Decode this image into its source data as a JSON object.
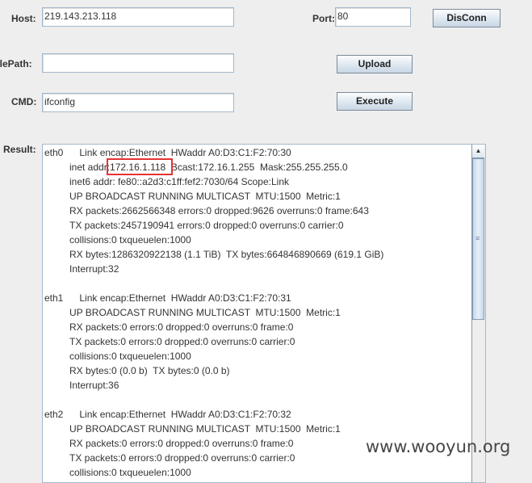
{
  "host": {
    "label": "Host:",
    "value": "219.143.213.118"
  },
  "port": {
    "label": "Port:",
    "value": "80"
  },
  "disconn_label": "DisConn",
  "filepath": {
    "label": "FilePath:",
    "value": ""
  },
  "upload_label": "Upload",
  "cmd": {
    "label": "CMD:",
    "value": "ifconfig"
  },
  "execute_label": "Execute",
  "result": {
    "label": "Result:",
    "lines": [
      "eth0      Link encap:Ethernet  HWaddr A0:D3:C1:F2:70:30",
      "inet addr:172.16.1.118  Bcast:172.16.1.255  Mask:255.255.255.0",
      "inet6 addr: fe80::a2d3:c1ff:fef2:7030/64 Scope:Link",
      "UP BROADCAST RUNNING MULTICAST  MTU:1500  Metric:1",
      "RX packets:2662566348 errors:0 dropped:9626 overruns:0 frame:643",
      "TX packets:2457190941 errors:0 dropped:0 overruns:0 carrier:0",
      "collisions:0 txqueuelen:1000",
      "RX bytes:1286320922138 (1.1 TiB)  TX bytes:664846890669 (619.1 GiB)",
      "Interrupt:32",
      "",
      "eth1      Link encap:Ethernet  HWaddr A0:D3:C1:F2:70:31",
      "UP BROADCAST RUNNING MULTICAST  MTU:1500  Metric:1",
      "RX packets:0 errors:0 dropped:0 overruns:0 frame:0",
      "TX packets:0 errors:0 dropped:0 overruns:0 carrier:0",
      "collisions:0 txqueuelen:1000",
      "RX bytes:0 (0.0 b)  TX bytes:0 (0.0 b)",
      "Interrupt:36",
      "",
      "eth2      Link encap:Ethernet  HWaddr A0:D3:C1:F2:70:32",
      "UP BROADCAST RUNNING MULTICAST  MTU:1500  Metric:1",
      "RX packets:0 errors:0 dropped:0 overruns:0 frame:0",
      "TX packets:0 errors:0 dropped:0 overruns:0 carrier:0",
      "collisions:0 txqueuelen:1000"
    ]
  },
  "highlight_color": "#e53333",
  "watermark": "www.wooyun.org"
}
